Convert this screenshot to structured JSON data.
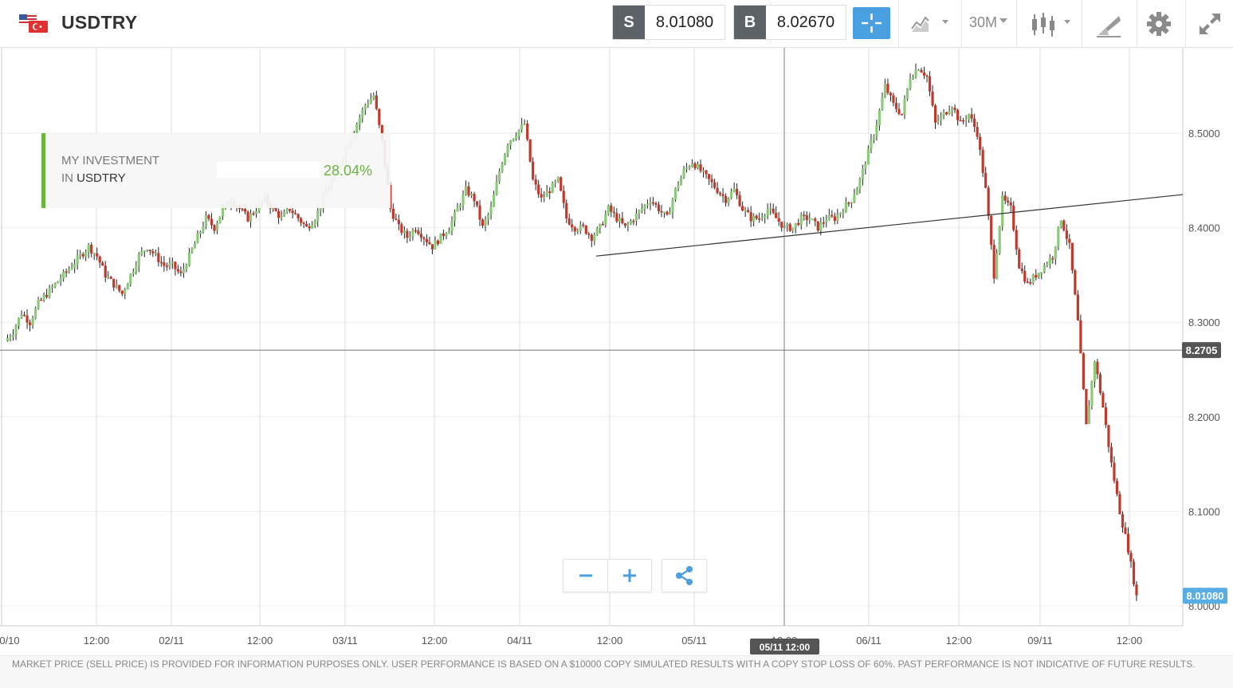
{
  "instrument": {
    "symbol": "USDTRY",
    "flag_icon": "usd-try-flag-icon"
  },
  "trade": {
    "sell_label": "S",
    "sell_price": "8.01080",
    "buy_label": "B",
    "buy_price": "8.02670"
  },
  "toolbar": {
    "crosshair_icon": "crosshair-icon",
    "chart_type_icon": "area-chart-icon",
    "timeframe": "30M",
    "candle_icon": "candlestick-icon",
    "draw_icon": "drawing-tools-icon",
    "settings_icon": "gear-icon",
    "fullscreen_icon": "expand-icon",
    "accent_color": "#4a9fe0"
  },
  "investment": {
    "line1": "MY INVESTMENT",
    "line2_prefix": "IN",
    "symbol": "USDTRY",
    "value": "28.04%",
    "color": "#6db33f"
  },
  "controls": {
    "zoom_out": "−",
    "zoom_in": "+",
    "share_icon": "share-icon"
  },
  "footer": {
    "disclaimer": "MARKET PRICE (SELL PRICE) IS PROVIDED FOR INFORMATION PURPOSES ONLY. USER PERFORMANCE IS BASED ON A $10000 COPY SIMULATED RESULTS WITH A COPY STOP LOSS OF 60%. PAST PERFORMANCE IS NOT INDICATIVE OF FUTURE RESULTS."
  },
  "chart_data": {
    "type": "candlestick",
    "ylim": [
      7.99,
      8.59
    ],
    "y_ticks": [
      "8.0000",
      "8.1000",
      "8.2000",
      "8.3000",
      "8.4000",
      "8.5000"
    ],
    "x_ticks": [
      "0/10",
      "12:00",
      "02/11",
      "12:00",
      "03/11",
      "12:00",
      "04/11",
      "12:00",
      "05/11",
      "12:00",
      "06/11",
      "12:00",
      "09/11",
      "12:00"
    ],
    "crosshair_price": "8.2705",
    "crosshair_time": "05/11 12:00",
    "current_price": "8.01080",
    "colors": {
      "up": "#8cc97a",
      "down": "#c0392b",
      "price_tag": "#5aade3",
      "crosshair_tag": "#555555"
    },
    "trendline": {
      "from": [
        8.37
      ],
      "to": [
        8.435
      ]
    },
    "price_path": [
      8.28,
      8.29,
      8.31,
      8.3,
      8.32,
      8.33,
      8.34,
      8.35,
      8.36,
      8.37,
      8.38,
      8.37,
      8.35,
      8.34,
      8.33,
      8.35,
      8.37,
      8.38,
      8.37,
      8.36,
      8.36,
      8.35,
      8.37,
      8.39,
      8.41,
      8.4,
      8.42,
      8.43,
      8.42,
      8.41,
      8.42,
      8.43,
      8.42,
      8.41,
      8.42,
      8.41,
      8.4,
      8.41,
      8.43,
      8.45,
      8.47,
      8.49,
      8.51,
      8.53,
      8.54,
      8.49,
      8.42,
      8.4,
      8.39,
      8.4,
      8.39,
      8.38,
      8.39,
      8.4,
      8.42,
      8.44,
      8.43,
      8.4,
      8.42,
      8.46,
      8.49,
      8.5,
      8.51,
      8.45,
      8.43,
      8.44,
      8.45,
      8.41,
      8.4,
      8.4,
      8.39,
      8.4,
      8.42,
      8.41,
      8.4,
      8.41,
      8.42,
      8.43,
      8.42,
      8.41,
      8.44,
      8.46,
      8.47,
      8.46,
      8.45,
      8.44,
      8.43,
      8.44,
      8.42,
      8.41,
      8.41,
      8.42,
      8.41,
      8.4,
      8.4,
      8.41,
      8.41,
      8.4,
      8.41,
      8.41,
      8.42,
      8.43,
      8.45,
      8.48,
      8.51,
      8.55,
      8.53,
      8.52,
      8.56,
      8.57,
      8.56,
      8.51,
      8.52,
      8.53,
      8.51,
      8.52,
      8.5,
      8.44,
      8.35,
      8.43,
      8.42,
      8.36,
      8.34,
      8.35,
      8.36,
      8.37,
      8.41,
      8.38,
      8.3,
      8.19,
      8.26,
      8.21,
      8.15,
      8.1,
      8.06,
      8.01
    ]
  }
}
